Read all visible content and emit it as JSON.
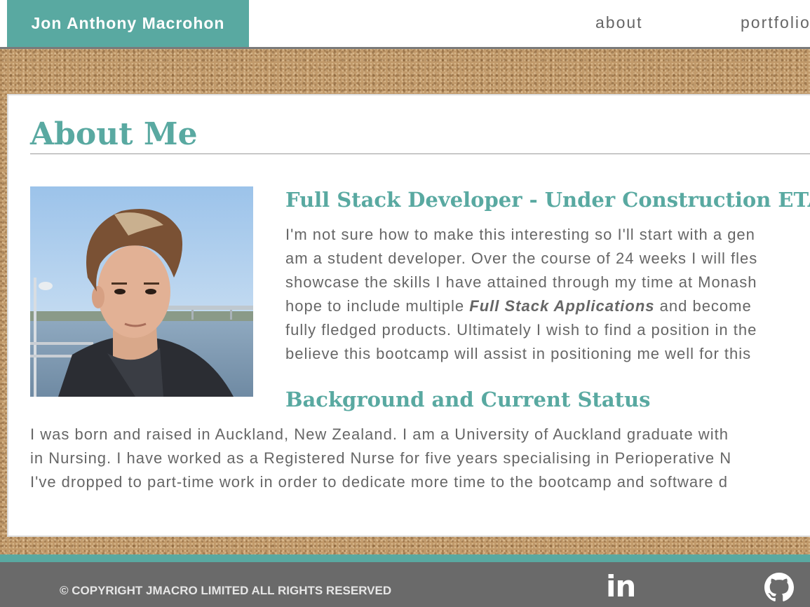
{
  "header": {
    "brand": "Jon Anthony Macrohon",
    "nav": [
      {
        "label": "about"
      },
      {
        "label": "portfolio"
      }
    ]
  },
  "about": {
    "title": "About Me",
    "section1": {
      "heading": "Full Stack Developer - Under Construction ETA",
      "lines": [
        "I'm not sure how to make this interesting so I'll start with a gen",
        "am a student developer. Over the course of 24 weeks I will fles",
        "showcase the skills I have attained through my time at Monash",
        "and become",
        "fully fledged products. Ultimately I wish to find a position in the",
        "believe this bootcamp will assist in positioning me well for this"
      ],
      "line4_prefix": "hope to include multiple",
      "line4_emphasis": "Full Stack Applications"
    },
    "section2": {
      "heading": "Background and Current Status",
      "lines": [
        "I was born and raised in Auckland, New Zealand. I am a University of Auckland graduate with",
        "in Nursing. I have worked as a Registered Nurse for five years specialising in Perioperative N",
        "I've dropped to part-time work in order to dedicate more time to the bootcamp and software d"
      ]
    }
  },
  "footer": {
    "copyright": "© COPYRIGHT JMACRO LIMITED ALL RIGHTS RESERVED",
    "icons": [
      "linkedin-icon",
      "github-icon"
    ],
    "linkedin_glyph": "in"
  },
  "colors": {
    "accent": "#59a9a1",
    "text": "#666666",
    "footer": "#6a6a6a"
  }
}
